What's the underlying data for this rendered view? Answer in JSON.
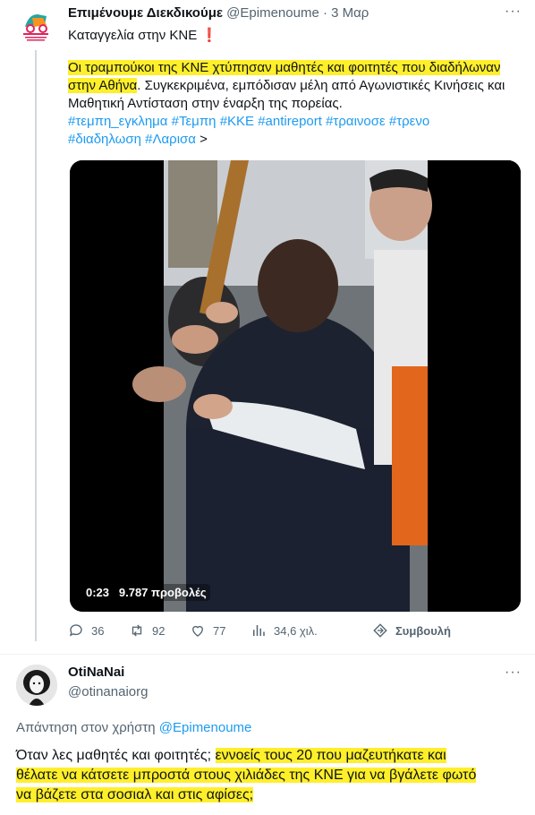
{
  "tweet1": {
    "author_name": "Επιμένουμε Διεκδικούμε",
    "handle": "@Epimenoume",
    "date": "3 Μαρ",
    "more": "···",
    "headline": "Καταγγελία στην ΚΝΕ",
    "headline_emoji": "❗",
    "body_hl_1": "Οι τραμπούκοι της ΚΝΕ χτύπησαν μαθητές και φοιτητές που διαδήλωναν",
    "body_hl_2": "στην Αθήνα",
    "body_rest_2": ". Συγκεκριμένα, εμπόδισαν μέλη από Αγωνιστικές Κινήσεις και",
    "body_line_3": "Μαθητική Αντίσταση στην έναρξη της πορείας.",
    "hashtags_line_1": "#τεμπη_εγκλημα #Τεμπη #ΚΚΕ #antireport #τραινοσε #τρενο",
    "hashtags_line_2": "#διαδηλωση #Λαρισα",
    "show_more": ">",
    "video_time": "0:23",
    "video_views": "9.787 προβολές",
    "stats": {
      "replies": "36",
      "retweets": "92",
      "likes": "77",
      "views": "34,6 χιλ.",
      "advice": "Συμβουλή"
    }
  },
  "tweet2": {
    "author_name": "OtiNaNai",
    "handle": "@otinanaiorg",
    "more": "···",
    "replying_prefix": "Απάντηση στον χρήστη",
    "replying_handle": "@Epimenoume",
    "line_1_plain": "Όταν λες μαθητές και φοιτητές;",
    "line_1_hl": "εννοείς τους 20 που μαζευτήκατε και",
    "line_2_hl": "θέλατε να κάτσετε μπροστά στους χιλιάδες της ΚΝΕ για να βγάλετε φωτό",
    "line_3_hl": "να βάζετε στα σοσιαλ και στις αφίσες;"
  },
  "colors": {
    "highlight": "#ffef2a",
    "link": "#1d9bf0",
    "muted": "#536471"
  }
}
